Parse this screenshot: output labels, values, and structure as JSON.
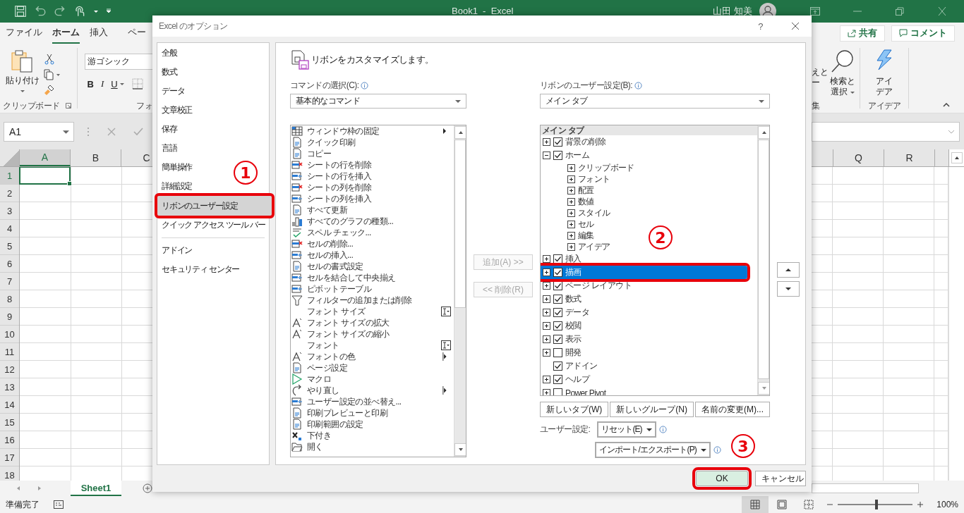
{
  "excel": {
    "title": "Book1  -  Excel",
    "user": "山田 知美",
    "ribbon_tabs": [
      {
        "label": "ファイル",
        "selected": false
      },
      {
        "label": "ホーム",
        "selected": true
      },
      {
        "label": "挿入",
        "selected": false
      },
      {
        "label": "ペー",
        "selected": false
      }
    ],
    "share_button": "共有",
    "comment_button": "コメント",
    "clipboard_group": {
      "paste": "貼り付け",
      "label": "クリップボード"
    },
    "font_group": {
      "font_name": "游ゴシック",
      "bold": "B",
      "italic": "I",
      "underline": "U",
      "label": "フォ"
    },
    "edit_group": {
      "fragments": [
        "えと",
        "ー"
      ],
      "find_select": [
        "検索と",
        "選択"
      ],
      "label": "集"
    },
    "ideas_group": {
      "button": [
        "アイ",
        "デア"
      ],
      "label": "アイデア"
    },
    "name_box": "A1",
    "columns_left": [
      "A",
      "B",
      "C"
    ],
    "columns_right": [
      "Q",
      "R"
    ],
    "rows": [
      "1",
      "2",
      "3",
      "4",
      "5",
      "6",
      "7",
      "8",
      "9",
      "10",
      "11",
      "12",
      "13",
      "14",
      "15",
      "16",
      "17",
      "18"
    ],
    "sheet_tabs": [
      {
        "label": "Sheet1",
        "selected": true
      }
    ],
    "status": "準備完了",
    "zoom_slider": {
      "level": 0.52
    },
    "zoom": "100%"
  },
  "dialog": {
    "title": "Excel のオプション",
    "help": "?",
    "nav_sections": [
      [
        {
          "label": "全般",
          "selected": false,
          "marked": false
        },
        {
          "label": "数式",
          "selected": false,
          "marked": false
        },
        {
          "label": "データ",
          "selected": false,
          "marked": false
        },
        {
          "label": "文章校正",
          "selected": false,
          "marked": false
        },
        {
          "label": "保存",
          "selected": false,
          "marked": false
        },
        {
          "label": "言語",
          "selected": false,
          "marked": false
        },
        {
          "label": "簡単操作",
          "selected": false,
          "marked": false
        },
        {
          "label": "詳細設定",
          "selected": false,
          "marked": false
        },
        {
          "label": "リボンのユーザー設定",
          "selected": true,
          "marked": true
        },
        {
          "label": "クイック アクセス ツール バー",
          "selected": false,
          "marked": false
        }
      ],
      [
        {
          "label": "アドイン",
          "selected": false,
          "marked": false
        },
        {
          "label": "セキュリティ センター",
          "selected": false,
          "marked": false
        }
      ]
    ],
    "heading": "リボンをカスタマイズします。",
    "commands_label": "コマンドの選択(C):",
    "commands_dropdown": "基本的なコマンド",
    "commands": [
      {
        "label": "ウィンドウ枠の固定",
        "kind": "submenu"
      },
      {
        "label": "クイック印刷",
        "kind": "plain"
      },
      {
        "label": "コピー",
        "kind": "plain"
      },
      {
        "label": "シートの行を削除",
        "kind": "plain"
      },
      {
        "label": "シートの行を挿入",
        "kind": "plain"
      },
      {
        "label": "シートの列を削除",
        "kind": "plain"
      },
      {
        "label": "シートの列を挿入",
        "kind": "plain"
      },
      {
        "label": "すべて更新",
        "kind": "plain"
      },
      {
        "label": "すべてのグラフの種類...",
        "kind": "plain"
      },
      {
        "label": "スペル チェック...",
        "kind": "plain"
      },
      {
        "label": "セルの削除...",
        "kind": "plain"
      },
      {
        "label": "セルの挿入...",
        "kind": "plain"
      },
      {
        "label": "セルの書式設定",
        "kind": "plain"
      },
      {
        "label": "セルを結合して中央揃え",
        "kind": "plain"
      },
      {
        "label": "ピボットテーブル",
        "kind": "plain"
      },
      {
        "label": "フィルターの追加または削除",
        "kind": "plain"
      },
      {
        "label": "フォント サイズ",
        "kind": "combo"
      },
      {
        "label": "フォント サイズの拡大",
        "kind": "plain"
      },
      {
        "label": "フォント サイズの縮小",
        "kind": "plain"
      },
      {
        "label": "フォント",
        "kind": "combo"
      },
      {
        "label": "フォントの色",
        "kind": "split"
      },
      {
        "label": "ページ設定",
        "kind": "plain"
      },
      {
        "label": "マクロ",
        "kind": "plain"
      },
      {
        "label": "やり直し",
        "kind": "split"
      },
      {
        "label": "ユーザー設定の並べ替え...",
        "kind": "plain"
      },
      {
        "label": "印刷プレビューと印刷",
        "kind": "plain"
      },
      {
        "label": "印刷範囲の設定",
        "kind": "plain"
      },
      {
        "label": "下付き",
        "kind": "plain"
      },
      {
        "label": "開く",
        "kind": "plain"
      }
    ],
    "add_button": {
      "label": "追加(A) >>",
      "disabled": true
    },
    "remove_button": {
      "label": "<< 削除(R)",
      "disabled": true
    },
    "ribbon_label": "リボンのユーザー設定(B):",
    "ribbon_dropdown": "メイン タブ",
    "tree_header": "メイン タブ",
    "tree": [
      {
        "label": "背景の削除",
        "expanded": false,
        "checked": true,
        "selected": false,
        "marked": false
      },
      {
        "label": "ホーム",
        "expanded": true,
        "checked": true,
        "selected": false,
        "marked": false,
        "children": [
          {
            "label": "クリップボード",
            "expanded": false,
            "selected": false
          },
          {
            "label": "フォント",
            "expanded": false,
            "selected": false
          },
          {
            "label": "配置",
            "expanded": false,
            "selected": false
          },
          {
            "label": "数値",
            "expanded": false,
            "selected": false
          },
          {
            "label": "スタイル",
            "expanded": false,
            "selected": false
          },
          {
            "label": "セル",
            "expanded": false,
            "selected": false
          },
          {
            "label": "編集",
            "expanded": false,
            "selected": false
          },
          {
            "label": "アイデア",
            "expanded": false,
            "selected": false
          }
        ]
      },
      {
        "label": "挿入",
        "expanded": false,
        "checked": true,
        "selected": false,
        "marked": false
      },
      {
        "label": "描画",
        "expanded": false,
        "checked": true,
        "selected": true,
        "marked": true
      },
      {
        "label": "ページ レイアウト",
        "expanded": false,
        "checked": true,
        "selected": false,
        "marked": false
      },
      {
        "label": "数式",
        "expanded": false,
        "checked": true,
        "selected": false,
        "marked": false
      },
      {
        "label": "データ",
        "expanded": false,
        "checked": true,
        "selected": false,
        "marked": false
      },
      {
        "label": "校閲",
        "expanded": false,
        "checked": true,
        "selected": false,
        "marked": false
      },
      {
        "label": "表示",
        "expanded": false,
        "checked": true,
        "selected": false,
        "marked": false
      },
      {
        "label": "開発",
        "expanded": false,
        "checked": false,
        "selected": false,
        "marked": false
      },
      {
        "label": "アドイン",
        "checked": true,
        "selected": false,
        "marked": false
      },
      {
        "label": "ヘルプ",
        "expanded": false,
        "checked": true,
        "selected": false,
        "marked": false
      },
      {
        "label": "Power Pivot",
        "expanded": false,
        "checked": false,
        "selected": false,
        "marked": false
      }
    ],
    "new_tab": "新しいタブ(W)",
    "new_group": "新しいグループ(N)",
    "rename": "名前の変更(M)...",
    "customizations_label": "ユーザー設定:",
    "reset": "リセット(E)",
    "import_export": "インポート/エクスポート(P)",
    "ok": {
      "label": "OK",
      "marked": true
    },
    "cancel": "キャンセル"
  },
  "annotations": [
    {
      "number": "1"
    },
    {
      "number": "2"
    },
    {
      "number": "3"
    }
  ]
}
